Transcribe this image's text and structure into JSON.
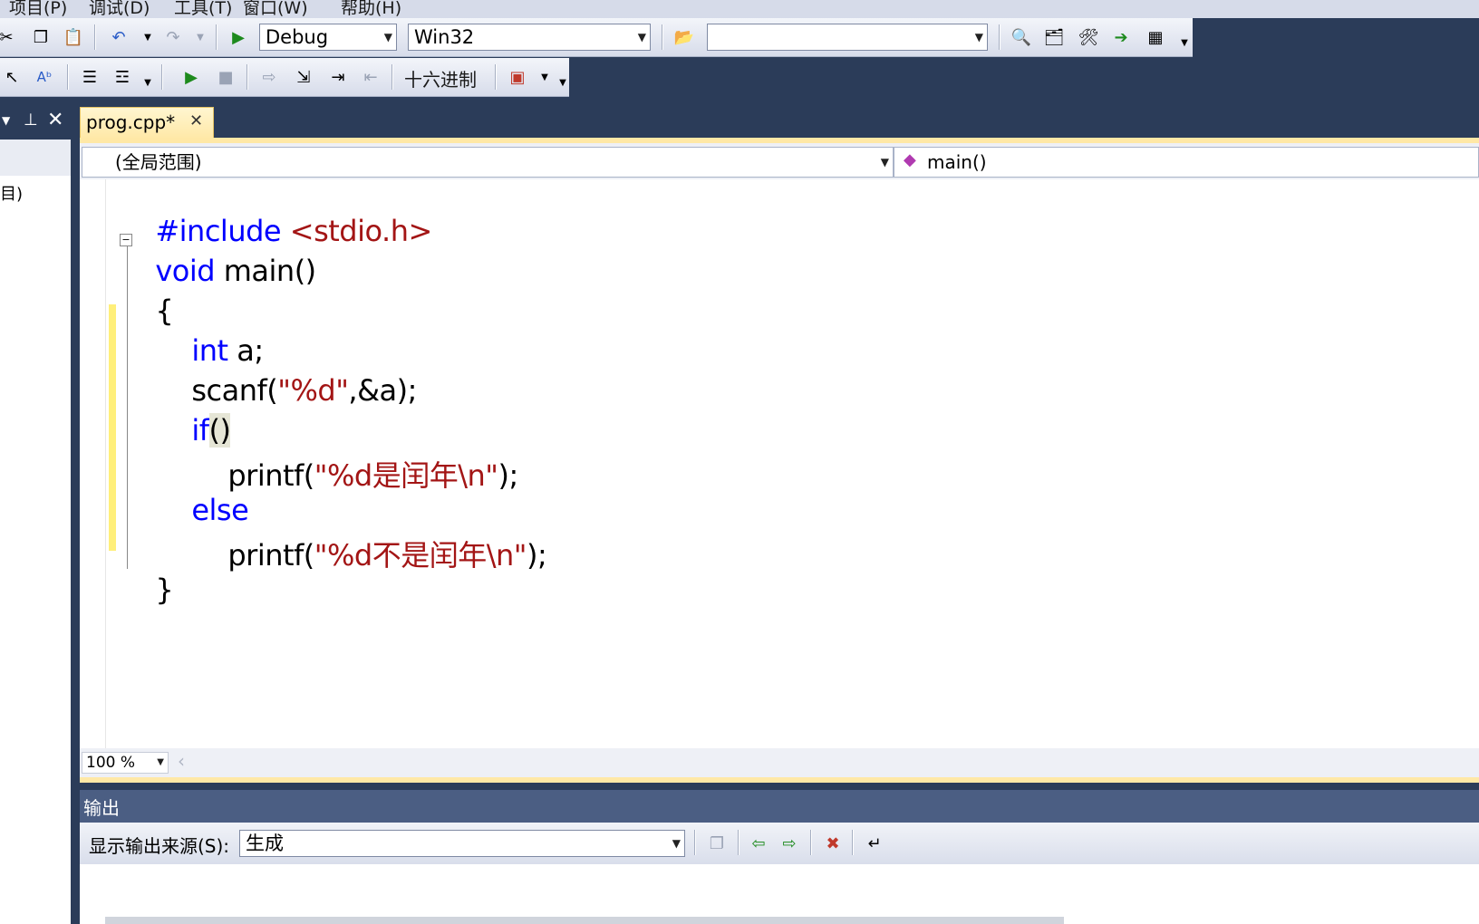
{
  "menu": {
    "items": [
      "项目(P)",
      "调试(D)",
      "工具(T)",
      "窗口(W)",
      "帮助(H)"
    ]
  },
  "toolbar": {
    "config_value": "Debug",
    "platform_value": "Win32",
    "search_value": "",
    "hex_label": "十六进制"
  },
  "editor": {
    "tab_label": "prog.cpp*",
    "scope_value": "(全局范围)",
    "member_value": "main()",
    "zoom_value": "100 %",
    "code": {
      "l1_a": "#include ",
      "l1_b": "<stdio.h>",
      "l2_a": "void",
      "l2_b": " main()",
      "l3": "{",
      "l4_a": "int",
      "l4_b": " a;",
      "l5_a": "scanf(",
      "l5_b": "\"%d\"",
      "l5_c": ",&a);",
      "l6_a": "if",
      "l6_b": "()",
      "l7_a": "printf(",
      "l7_b": "\"%d是闰年\\n\"",
      "l7_c": ");",
      "l8": "else",
      "l9_a": "printf(",
      "l9_b": "\"%d不是闰年\\n\"",
      "l9_c": ");",
      "l10": "}"
    }
  },
  "left_panel": {
    "partial_text": "目)"
  },
  "output": {
    "title": "输出",
    "source_label": "显示输出来源(S):",
    "source_value": "生成"
  },
  "colors": {
    "keyword": "#0000ff",
    "string": "#a31515",
    "chrome": "#2b3c59",
    "tab_active": "#ffe8a6"
  }
}
